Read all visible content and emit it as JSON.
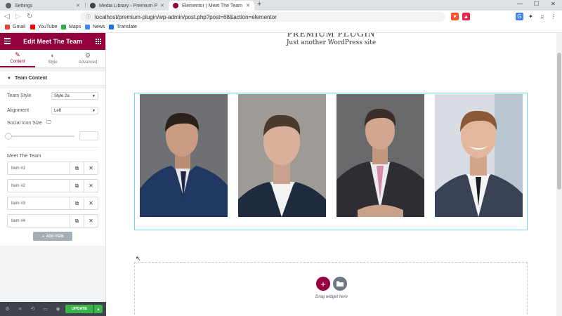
{
  "browser": {
    "tabs": [
      {
        "label": "Settings",
        "active": false
      },
      {
        "label": "Media Library ‹ Premium Plugin — W",
        "active": false
      },
      {
        "label": "Elementor | Meet The Team",
        "active": true
      }
    ],
    "new_tab": "+",
    "url": "localhost/premium-plugin/wp-admin/post.php?post=68&action=elementor",
    "bookmarks": [
      "Gmail",
      "YouTube",
      "Maps",
      "News",
      "Translate"
    ]
  },
  "panel": {
    "title": "Edit Meet The Team",
    "tabs": [
      {
        "label": "Content",
        "icon": "pencil-icon",
        "active": true
      },
      {
        "label": "Style",
        "icon": "contrast-icon",
        "active": false
      },
      {
        "label": "Advanced",
        "icon": "gear-icon",
        "active": false
      }
    ],
    "section_title": "Team Content",
    "team_style": {
      "label": "Team Style",
      "value": "Style 2a"
    },
    "alignment": {
      "label": "Alignment",
      "value": "Left"
    },
    "social_icon_size": {
      "label": "Social Icon Size",
      "value": ""
    },
    "repeater": {
      "title": "Meet The Team",
      "items": [
        "Item #1",
        "Item #2",
        "Item #3",
        "Item #4"
      ]
    },
    "add_item": "ADD ITEM",
    "footer": {
      "update": "UPDATE"
    }
  },
  "preview": {
    "site_title": "PREMIUM PLUGIN",
    "tagline": "Just another WordPress site",
    "drop_text": "Drag widget here"
  },
  "colors": {
    "brand": "#93003c",
    "update": "#39b54a",
    "selection_outline": "#71d7f7"
  }
}
